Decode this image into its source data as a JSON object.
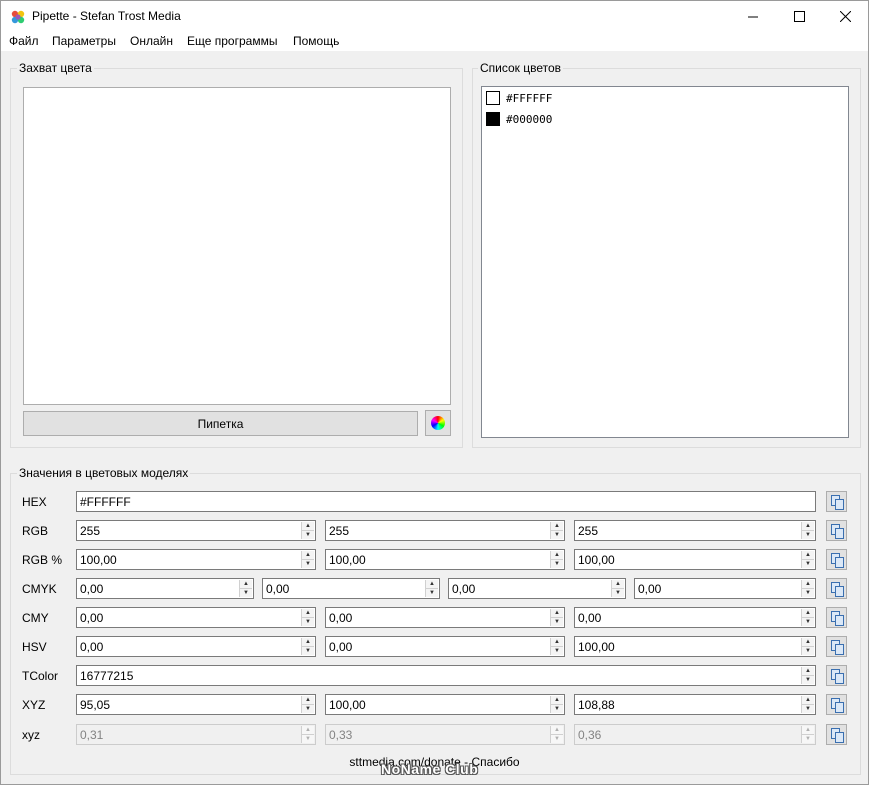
{
  "window": {
    "title": "Pipette - Stefan Trost Media"
  },
  "menu": {
    "items": [
      "Файл",
      "Параметры",
      "Онлайн",
      "Еще программы",
      "Помощь"
    ]
  },
  "capture": {
    "group_title": "Захват цвета",
    "pipette_label": "Пипетка"
  },
  "color_list": {
    "group_title": "Список цветов",
    "items": [
      {
        "hex": "#FFFFFF",
        "swatch": "#FFFFFF"
      },
      {
        "hex": "#000000",
        "swatch": "#000000"
      }
    ]
  },
  "models": {
    "group_title": "Значения в цветовых моделях",
    "hex": {
      "label": "HEX",
      "value": "#FFFFFF"
    },
    "rgb": {
      "label": "RGB",
      "values": [
        "255",
        "255",
        "255"
      ]
    },
    "rgb_pct": {
      "label": "RGB %",
      "values": [
        "100,00",
        "100,00",
        "100,00"
      ]
    },
    "cmyk": {
      "label": "CMYK",
      "values": [
        "0,00",
        "0,00",
        "0,00",
        "0,00"
      ]
    },
    "cmy": {
      "label": "CMY",
      "values": [
        "0,00",
        "0,00",
        "0,00"
      ]
    },
    "hsv": {
      "label": "HSV",
      "values": [
        "0,00",
        "0,00",
        "100,00"
      ]
    },
    "tcolor": {
      "label": "TColor",
      "value": "16777215"
    },
    "xyz": {
      "label": "XYZ",
      "values": [
        "95,05",
        "100,00",
        "108,88"
      ]
    },
    "xyz_small": {
      "label": "xyz",
      "values": [
        "0,31",
        "0,33",
        "0,36"
      ]
    }
  },
  "footer": {
    "link": "sttmedia.com/donate - Спасибо",
    "watermark": "NoName Club"
  }
}
